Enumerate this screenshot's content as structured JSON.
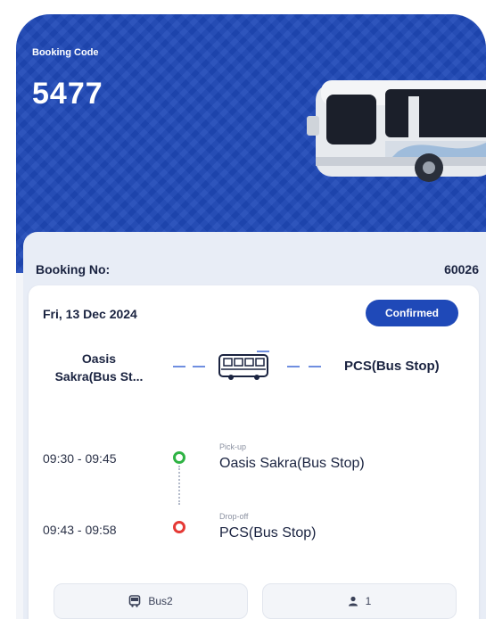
{
  "booking": {
    "code_label": "Booking Code",
    "code": "5477",
    "number_label": "Booking No:",
    "number": "60026",
    "date": "Fri, 13 Dec 2024",
    "status": "Confirmed"
  },
  "route": {
    "from_line1": "Oasis",
    "from_line2": "Sakra(Bus St...",
    "to": "PCS(Bus Stop)"
  },
  "stops": [
    {
      "time": "09:30 - 09:45",
      "type_label": "Pick-up",
      "name": "Oasis Sakra(Bus Stop)",
      "marker": "green"
    },
    {
      "time": "09:43 - 09:58",
      "type_label": "Drop-off",
      "name": "PCS(Bus Stop)",
      "marker": "red"
    }
  ],
  "footer": {
    "bus_label": "Bus2",
    "passengers": "1",
    "bus_icon": "bus-icon",
    "person_icon": "person-icon"
  },
  "colors": {
    "primary": "#1f49b8",
    "pickup": "#2fb344",
    "dropoff": "#e53935"
  }
}
